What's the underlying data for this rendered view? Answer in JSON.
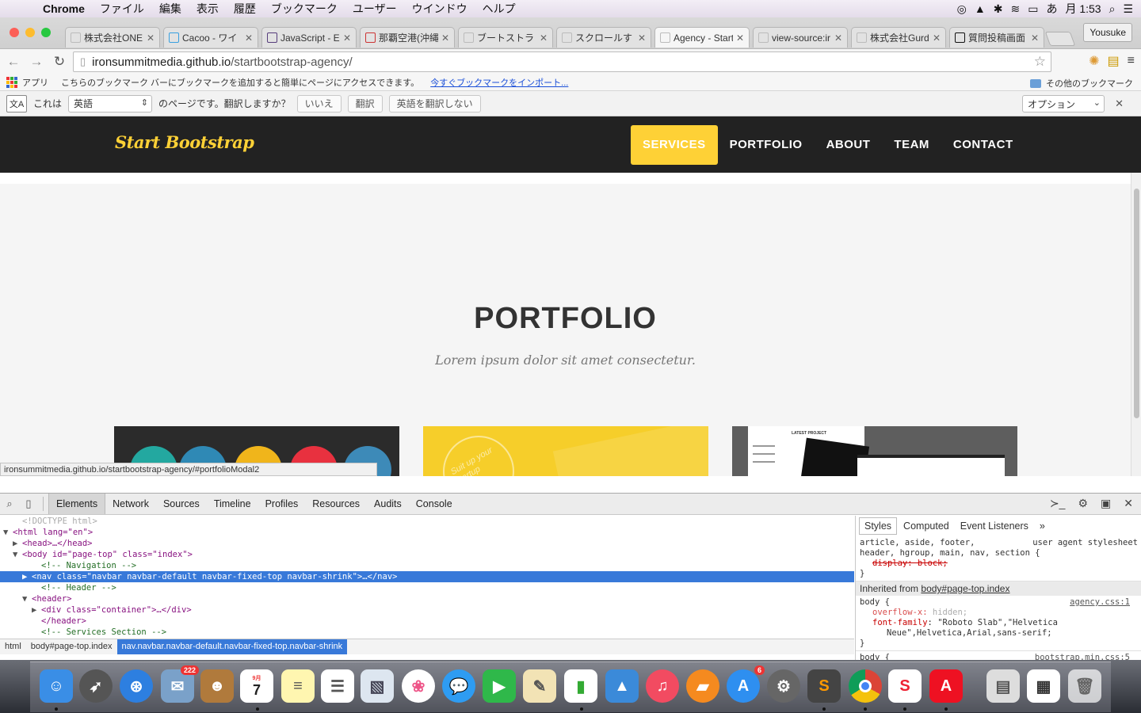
{
  "menubar": {
    "app_name": "Chrome",
    "items": [
      "ファイル",
      "編集",
      "表示",
      "履歴",
      "ブックマーク",
      "ユーザー",
      "ウインドウ",
      "ヘルプ"
    ],
    "clock": "月 1:53",
    "ime": "あ"
  },
  "tabs": [
    {
      "title": "株式会社ONE",
      "active": false
    },
    {
      "title": "Cacoo - ワイ",
      "active": false
    },
    {
      "title": "JavaScript - E",
      "active": false
    },
    {
      "title": "那覇空港(沖縄",
      "active": false
    },
    {
      "title": "ブートストラ",
      "active": false
    },
    {
      "title": "スクロールす",
      "active": false
    },
    {
      "title": "Agency - Start",
      "active": true
    },
    {
      "title": "view-source:ir",
      "active": false
    },
    {
      "title": "株式会社Gurd",
      "active": false
    },
    {
      "title": "質問投稿画面",
      "active": false
    }
  ],
  "profile_name": "Yousuke",
  "address": {
    "host": "ironsummitmedia.github.io",
    "path": "/startbootstrap-agency/"
  },
  "bookmarks_bar": {
    "apps_label": "アプリ",
    "hint": "こちらのブックマーク バーにブックマークを追加すると簡単にページにアクセスできます。",
    "import_link": "今すぐブックマークをインポート...",
    "other_label": "その他のブックマーク"
  },
  "translate_bar": {
    "prefix": "これは",
    "language": "英語",
    "question": "のページです。翻訳しますか？",
    "no_button": "いいえ",
    "translate_button": "翻訳",
    "never_button": "英語を翻訳しない",
    "options_label": "オプション"
  },
  "site": {
    "brand": "Start Bootstrap",
    "menu": [
      {
        "label": "SERVICES",
        "active": true
      },
      {
        "label": "PORTFOLIO",
        "active": false
      },
      {
        "label": "ABOUT",
        "active": false
      },
      {
        "label": "TEAM",
        "active": false
      },
      {
        "label": "CONTACT",
        "active": false
      }
    ],
    "section_title": "PORTFOLIO",
    "section_subtitle": "Lorem ipsum dolor sit amet consectetur.",
    "accent_color": "#fed136",
    "thumb2_text": "Suit up your startup",
    "thumb3_title": "LATEST PROJECT"
  },
  "status_url": "ironsummitmedia.github.io/startbootstrap-agency/#portfolioModal2",
  "devtools": {
    "tabs": [
      "Elements",
      "Network",
      "Sources",
      "Timeline",
      "Profiles",
      "Resources",
      "Audits",
      "Console"
    ],
    "active_tab": "Elements",
    "dom_lines": [
      {
        "tri": "",
        "text": "<!DOCTYPE html>",
        "kind": "doc",
        "indent": 1
      },
      {
        "tri": "▼",
        "text": "<html lang=\"en\">",
        "kind": "tag",
        "indent": 0
      },
      {
        "tri": "▶",
        "text": "<head>…</head>",
        "kind": "tag",
        "indent": 1
      },
      {
        "tri": "▼",
        "text": "<body id=\"page-top\" class=\"index\">",
        "kind": "tag",
        "indent": 1
      },
      {
        "tri": "",
        "text": "<!-- Navigation -->",
        "kind": "cmt",
        "indent": 3
      },
      {
        "tri": "▶",
        "text": "<nav class=\"navbar navbar-default navbar-fixed-top navbar-shrink\">…</nav>",
        "kind": "sel",
        "indent": 2
      },
      {
        "tri": "",
        "text": "<!-- Header -->",
        "kind": "cmt",
        "indent": 3
      },
      {
        "tri": "▼",
        "text": "<header>",
        "kind": "tag",
        "indent": 2
      },
      {
        "tri": "▶",
        "text": "<div class=\"container\">…</div>",
        "kind": "tag",
        "indent": 3
      },
      {
        "tri": "",
        "text": "</header>",
        "kind": "tag",
        "indent": 3
      },
      {
        "tri": "",
        "text": "<!-- Services Section -->",
        "kind": "cmt",
        "indent": 3
      },
      {
        "tri": "▶",
        "text": "<section id=\"services\">…</section>",
        "kind": "tag",
        "indent": 2
      },
      {
        "tri": "",
        "text": "<!-- Portfolio Grid Section -->",
        "kind": "cmt",
        "indent": 3
      }
    ],
    "breadcrumbs": [
      "html",
      "body#page-top.index",
      "nav.navbar.navbar-default.navbar-fixed-top.navbar-shrink"
    ],
    "styles_tabs": [
      "Styles",
      "Computed",
      "Event Listeners",
      "»"
    ],
    "ua_selector_1": "article, aside, footer,",
    "ua_source": "user agent stylesheet",
    "ua_selector_2": "header, hgroup, main, nav, section {",
    "ua_decl": "display: block;",
    "inherited_label": "Inherited from",
    "inherited_from": "body#page-top.index",
    "body_rule_selector": "body {",
    "body_rule_source": "agency.css:1",
    "body_decl_1_prop": "overflow-x",
    "body_decl_1_val": "hidden;",
    "body_decl_2_prop": "font-family",
    "body_decl_2_val": "\"Roboto Slab\",\"Helvetica",
    "body_decl_2_val_cont": "Neue\",Helvetica,Arial,sans-serif;",
    "body_rule2_selector": "body {",
    "body_rule2_source": "bootstrap.min.css:5"
  },
  "dock": {
    "calendar_month": "9月",
    "calendar_day": "7",
    "mail_badge": "222",
    "appstore_badge": "6"
  }
}
